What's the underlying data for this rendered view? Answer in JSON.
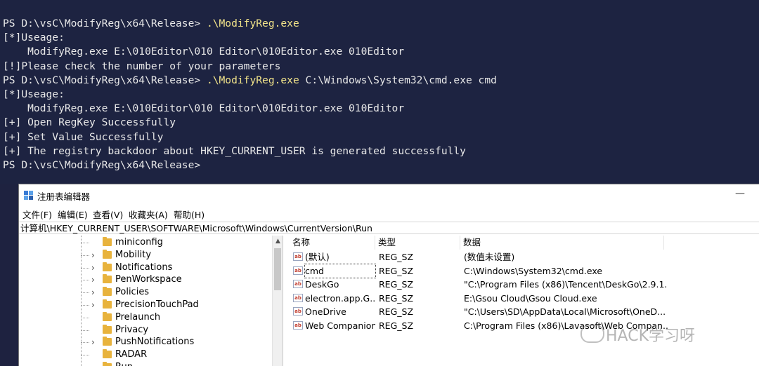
{
  "terminal": {
    "lines": [
      {
        "prompt": "PS D:\\vsC\\ModifyReg\\x64\\Release> ",
        "cmd": ".\\ModifyReg.exe",
        "args": ""
      },
      {
        "text": "[*]Useage:"
      },
      {
        "text": "    ModifyReg.exe E:\\010Editor\\010 Editor\\010Editor.exe 010Editor"
      },
      {
        "text": "[!]Please check the number of your parameters"
      },
      {
        "prompt": "PS D:\\vsC\\ModifyReg\\x64\\Release> ",
        "cmd": ".\\ModifyReg.exe",
        "args": " C:\\Windows\\System32\\cmd.exe cmd"
      },
      {
        "text": "[*]Useage:"
      },
      {
        "text": "    ModifyReg.exe E:\\010Editor\\010 Editor\\010Editor.exe 010Editor"
      },
      {
        "text": "[+] Open RegKey Successfully"
      },
      {
        "text": "[+] Set Value Successfully"
      },
      {
        "text": "[+] The registry backdoor about HKEY_CURRENT_USER is generated successfully"
      },
      {
        "prompt": "PS D:\\vsC\\ModifyReg\\x64\\Release>",
        "cmd": "",
        "args": ""
      }
    ]
  },
  "regedit": {
    "title": "注册表编辑器",
    "minimize_symbol": "—",
    "menu": [
      "文件(F)",
      "编辑(E)",
      "查看(V)",
      "收藏夹(A)",
      "帮助(H)"
    ],
    "address": "计算机\\HKEY_CURRENT_USER\\SOFTWARE\\Microsoft\\Windows\\CurrentVersion\\Run",
    "tree": [
      {
        "label": "miniconfig",
        "expandable": false
      },
      {
        "label": "Mobility",
        "expandable": true
      },
      {
        "label": "Notifications",
        "expandable": true
      },
      {
        "label": "PenWorkspace",
        "expandable": true
      },
      {
        "label": "Policies",
        "expandable": true
      },
      {
        "label": "PrecisionTouchPad",
        "expandable": true
      },
      {
        "label": "Prelaunch",
        "expandable": false
      },
      {
        "label": "Privacy",
        "expandable": false
      },
      {
        "label": "PushNotifications",
        "expandable": true
      },
      {
        "label": "RADAR",
        "expandable": false
      },
      {
        "label": "Run",
        "expandable": false
      }
    ],
    "columns": [
      "名称",
      "类型",
      "数据"
    ],
    "values": [
      {
        "name": "(默认)",
        "type": "REG_SZ",
        "data": "(数值未设置)"
      },
      {
        "name": "cmd",
        "type": "REG_SZ",
        "data": "C:\\Windows\\System32\\cmd.exe"
      },
      {
        "name": "DeskGo",
        "type": "REG_SZ",
        "data": "\"C:\\Program Files (x86)\\Tencent\\DeskGo\\2.9.1..."
      },
      {
        "name": "electron.app.G...",
        "type": "REG_SZ",
        "data": "E:\\Gsou Cloud\\Gsou Cloud.exe"
      },
      {
        "name": "OneDrive",
        "type": "REG_SZ",
        "data": "\"C:\\Users\\SD\\AppData\\Local\\Microsoft\\OneD..."
      },
      {
        "name": "Web Companion",
        "type": "REG_SZ",
        "data": "C:\\Program Files (x86)\\Lavasoft\\Web Compan..."
      }
    ],
    "value_icon_text": "ab"
  },
  "watermark": "HACK学习呀"
}
